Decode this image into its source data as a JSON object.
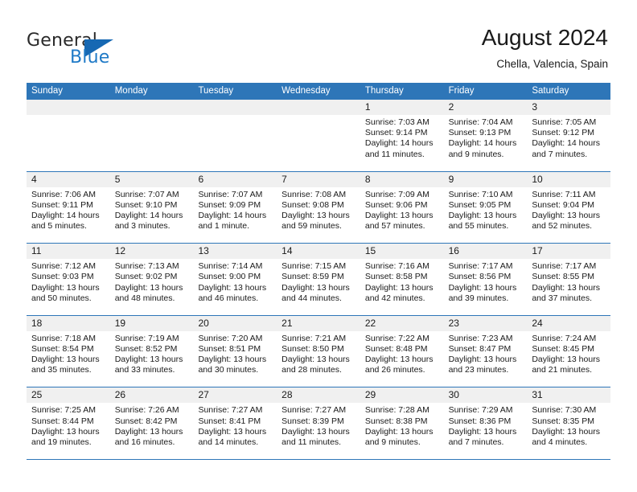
{
  "brand": {
    "name_top": "General",
    "name_bottom": "Blue",
    "accent_color": "#1668b3",
    "text_color": "#2a2a2a"
  },
  "header": {
    "title": "August 2024",
    "subtitle": "Chella, Valencia, Spain"
  },
  "theme": {
    "header_row_bg": "#2e76b8",
    "day_band_bg": "#f0f0f0",
    "divider_color": "#2e76b8"
  },
  "weekdays": [
    "Sunday",
    "Monday",
    "Tuesday",
    "Wednesday",
    "Thursday",
    "Friday",
    "Saturday"
  ],
  "weeks": [
    [
      {
        "day": "",
        "lines": []
      },
      {
        "day": "",
        "lines": []
      },
      {
        "day": "",
        "lines": []
      },
      {
        "day": "",
        "lines": []
      },
      {
        "day": "1",
        "lines": [
          "Sunrise: 7:03 AM",
          "Sunset: 9:14 PM",
          "Daylight: 14 hours",
          "and 11 minutes."
        ]
      },
      {
        "day": "2",
        "lines": [
          "Sunrise: 7:04 AM",
          "Sunset: 9:13 PM",
          "Daylight: 14 hours",
          "and 9 minutes."
        ]
      },
      {
        "day": "3",
        "lines": [
          "Sunrise: 7:05 AM",
          "Sunset: 9:12 PM",
          "Daylight: 14 hours",
          "and 7 minutes."
        ]
      }
    ],
    [
      {
        "day": "4",
        "lines": [
          "Sunrise: 7:06 AM",
          "Sunset: 9:11 PM",
          "Daylight: 14 hours",
          "and 5 minutes."
        ]
      },
      {
        "day": "5",
        "lines": [
          "Sunrise: 7:07 AM",
          "Sunset: 9:10 PM",
          "Daylight: 14 hours",
          "and 3 minutes."
        ]
      },
      {
        "day": "6",
        "lines": [
          "Sunrise: 7:07 AM",
          "Sunset: 9:09 PM",
          "Daylight: 14 hours",
          "and 1 minute."
        ]
      },
      {
        "day": "7",
        "lines": [
          "Sunrise: 7:08 AM",
          "Sunset: 9:08 PM",
          "Daylight: 13 hours",
          "and 59 minutes."
        ]
      },
      {
        "day": "8",
        "lines": [
          "Sunrise: 7:09 AM",
          "Sunset: 9:06 PM",
          "Daylight: 13 hours",
          "and 57 minutes."
        ]
      },
      {
        "day": "9",
        "lines": [
          "Sunrise: 7:10 AM",
          "Sunset: 9:05 PM",
          "Daylight: 13 hours",
          "and 55 minutes."
        ]
      },
      {
        "day": "10",
        "lines": [
          "Sunrise: 7:11 AM",
          "Sunset: 9:04 PM",
          "Daylight: 13 hours",
          "and 52 minutes."
        ]
      }
    ],
    [
      {
        "day": "11",
        "lines": [
          "Sunrise: 7:12 AM",
          "Sunset: 9:03 PM",
          "Daylight: 13 hours",
          "and 50 minutes."
        ]
      },
      {
        "day": "12",
        "lines": [
          "Sunrise: 7:13 AM",
          "Sunset: 9:02 PM",
          "Daylight: 13 hours",
          "and 48 minutes."
        ]
      },
      {
        "day": "13",
        "lines": [
          "Sunrise: 7:14 AM",
          "Sunset: 9:00 PM",
          "Daylight: 13 hours",
          "and 46 minutes."
        ]
      },
      {
        "day": "14",
        "lines": [
          "Sunrise: 7:15 AM",
          "Sunset: 8:59 PM",
          "Daylight: 13 hours",
          "and 44 minutes."
        ]
      },
      {
        "day": "15",
        "lines": [
          "Sunrise: 7:16 AM",
          "Sunset: 8:58 PM",
          "Daylight: 13 hours",
          "and 42 minutes."
        ]
      },
      {
        "day": "16",
        "lines": [
          "Sunrise: 7:17 AM",
          "Sunset: 8:56 PM",
          "Daylight: 13 hours",
          "and 39 minutes."
        ]
      },
      {
        "day": "17",
        "lines": [
          "Sunrise: 7:17 AM",
          "Sunset: 8:55 PM",
          "Daylight: 13 hours",
          "and 37 minutes."
        ]
      }
    ],
    [
      {
        "day": "18",
        "lines": [
          "Sunrise: 7:18 AM",
          "Sunset: 8:54 PM",
          "Daylight: 13 hours",
          "and 35 minutes."
        ]
      },
      {
        "day": "19",
        "lines": [
          "Sunrise: 7:19 AM",
          "Sunset: 8:52 PM",
          "Daylight: 13 hours",
          "and 33 minutes."
        ]
      },
      {
        "day": "20",
        "lines": [
          "Sunrise: 7:20 AM",
          "Sunset: 8:51 PM",
          "Daylight: 13 hours",
          "and 30 minutes."
        ]
      },
      {
        "day": "21",
        "lines": [
          "Sunrise: 7:21 AM",
          "Sunset: 8:50 PM",
          "Daylight: 13 hours",
          "and 28 minutes."
        ]
      },
      {
        "day": "22",
        "lines": [
          "Sunrise: 7:22 AM",
          "Sunset: 8:48 PM",
          "Daylight: 13 hours",
          "and 26 minutes."
        ]
      },
      {
        "day": "23",
        "lines": [
          "Sunrise: 7:23 AM",
          "Sunset: 8:47 PM",
          "Daylight: 13 hours",
          "and 23 minutes."
        ]
      },
      {
        "day": "24",
        "lines": [
          "Sunrise: 7:24 AM",
          "Sunset: 8:45 PM",
          "Daylight: 13 hours",
          "and 21 minutes."
        ]
      }
    ],
    [
      {
        "day": "25",
        "lines": [
          "Sunrise: 7:25 AM",
          "Sunset: 8:44 PM",
          "Daylight: 13 hours",
          "and 19 minutes."
        ]
      },
      {
        "day": "26",
        "lines": [
          "Sunrise: 7:26 AM",
          "Sunset: 8:42 PM",
          "Daylight: 13 hours",
          "and 16 minutes."
        ]
      },
      {
        "day": "27",
        "lines": [
          "Sunrise: 7:27 AM",
          "Sunset: 8:41 PM",
          "Daylight: 13 hours",
          "and 14 minutes."
        ]
      },
      {
        "day": "28",
        "lines": [
          "Sunrise: 7:27 AM",
          "Sunset: 8:39 PM",
          "Daylight: 13 hours",
          "and 11 minutes."
        ]
      },
      {
        "day": "29",
        "lines": [
          "Sunrise: 7:28 AM",
          "Sunset: 8:38 PM",
          "Daylight: 13 hours",
          "and 9 minutes."
        ]
      },
      {
        "day": "30",
        "lines": [
          "Sunrise: 7:29 AM",
          "Sunset: 8:36 PM",
          "Daylight: 13 hours",
          "and 7 minutes."
        ]
      },
      {
        "day": "31",
        "lines": [
          "Sunrise: 7:30 AM",
          "Sunset: 8:35 PM",
          "Daylight: 13 hours",
          "and 4 minutes."
        ]
      }
    ]
  ]
}
